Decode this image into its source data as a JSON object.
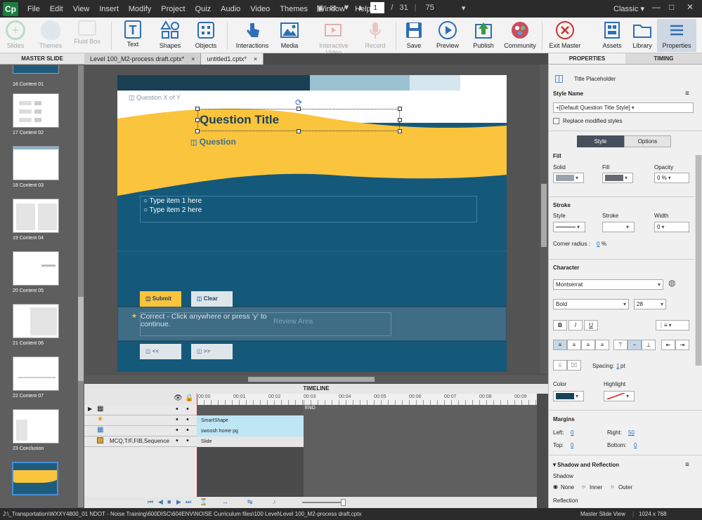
{
  "menubar": {
    "logo": "Cp",
    "items": [
      "File",
      "Edit",
      "View",
      "Insert",
      "Modify",
      "Project",
      "Quiz",
      "Audio",
      "Video",
      "Themes",
      "Window",
      "Help"
    ],
    "page_current": "1",
    "page_sep": "/",
    "page_total": "31",
    "zoom": "75",
    "workspace": "Classic"
  },
  "toolbar": {
    "slides": "Slides",
    "themes": "Themes",
    "fluid_box": "Fluid Box",
    "text": "Text",
    "shapes": "Shapes",
    "objects": "Objects",
    "interactions": "Interactions",
    "media": "Media",
    "interactive_video": "Interactive Video",
    "record": "Record",
    "save": "Save",
    "preview": "Preview",
    "publish": "Publish",
    "community": "Community",
    "exit_master": "Exit Master",
    "assets": "Assets",
    "library": "Library",
    "properties": "Properties"
  },
  "left_panel": {
    "header": "MASTER SLIDE",
    "thumbnails": [
      {
        "label": "16 Content 01"
      },
      {
        "label": "17 Content 02"
      },
      {
        "label": "18 Content 03"
      },
      {
        "label": "19 Content 04"
      },
      {
        "label": "20 Content 05"
      },
      {
        "label": "21 Content 06"
      },
      {
        "label": "22 Content 07"
      },
      {
        "label": "23 Conclusion"
      }
    ]
  },
  "doc_tabs": [
    {
      "label": "Level 100_M2-process draft.cptx*",
      "close": "×"
    },
    {
      "label": "untitled1.cptx*",
      "close": "×"
    }
  ],
  "slide": {
    "question_x_of_y": "Question X of Y",
    "title": "Question Title",
    "question": "Question",
    "item1": "Type item 1 here",
    "item2": "Type item 2 here",
    "submit": "Submit",
    "clear": "Clear",
    "feedback_line1": "Correct - Click anywhere or press 'y' to",
    "feedback_line2": "continue.",
    "review_area": "Review Area",
    "prev": "<<",
    "next": ">>"
  },
  "timeline": {
    "header": "TIMELINE",
    "ticks": [
      "00:00",
      "00:01",
      "00:02",
      "00:03",
      "00:04",
      "00:05",
      "00:06",
      "00:07",
      "00:08",
      "00:09"
    ],
    "end_label": "END",
    "rows": [
      {
        "name": "",
        "bar": ""
      },
      {
        "name": "",
        "bar": "SmartShape"
      },
      {
        "name": "",
        "bar": "swoosh home pg"
      },
      {
        "name": "MCQ,T/F,FIB,Sequence",
        "bar": "Slide"
      }
    ]
  },
  "properties": {
    "tabs": [
      "PROPERTIES",
      "TIMING"
    ],
    "object_name": "Title Placeholder",
    "style_name_label": "Style Name",
    "style_name_value": "+[Default Question Title Style]",
    "replace_modified": "Replace modified styles",
    "subtab_style": "Style",
    "subtab_options": "Options",
    "fill_section": "Fill",
    "fill_solid": "Solid",
    "fill_fill": "Fill",
    "fill_opacity": "Opacity",
    "opacity_value": "0 %",
    "stroke_section": "Stroke",
    "stroke_style": "Style",
    "stroke_stroke": "Stroke",
    "stroke_width": "Width",
    "width_value": "0",
    "corner_radius": "Corner radius :",
    "corner_value": "0",
    "corner_unit": "%",
    "character_section": "Character",
    "font_family": "Montserrat",
    "font_style": "Bold",
    "font_size": "28",
    "spacing_label": "Spacing:",
    "spacing_value": "1",
    "spacing_unit": "pt",
    "color_label": "Color",
    "highlight_label": "Highlight",
    "margins_section": "Margins",
    "left_label": "Left:",
    "left_value": "0",
    "right_label": "Right:",
    "right_value": "50",
    "top_label": "Top:",
    "top_value": "0",
    "bottom_label": "Bottom:",
    "bottom_value": "0",
    "shadow_section": "Shadow and Reflection",
    "shadow_label": "Shadow",
    "shadow_none": "None",
    "shadow_inner": "Inner",
    "shadow_outer": "Outer",
    "reflection": "Reflection",
    "colors": {
      "text_color": "#15445a",
      "fill_color": "#9aa3ad",
      "fill_fill": "#666a70"
    }
  },
  "statusbar": {
    "path": "J:\\_Transportation\\WXXY4800_01 NDOT - Noise Training\\600DISC\\604ENV\\NOISE Curriculum files\\100 Level\\Level 100_M2-process draft.cptx",
    "view": "Master Slide View",
    "resolution": "1024 x 768"
  },
  "colors": {
    "slide_blue": "#15597a",
    "slide_yellow": "#fbc43d",
    "slide_dark": "#1b3f55",
    "accent_blue": "#1a6ec7"
  }
}
